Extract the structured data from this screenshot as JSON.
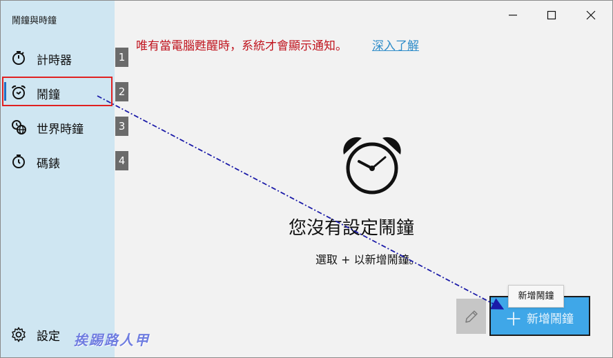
{
  "app": {
    "title": "鬧鐘與時鐘"
  },
  "sidebar": {
    "items": [
      {
        "label": "計時器",
        "icon": "timer-icon",
        "badge": "1"
      },
      {
        "label": "鬧鐘",
        "icon": "alarm-clock-icon",
        "badge": "2",
        "selected": true
      },
      {
        "label": "世界時鐘",
        "icon": "world-clock-icon",
        "badge": "3"
      },
      {
        "label": "碼錶",
        "icon": "stopwatch-icon",
        "badge": "4"
      }
    ],
    "settings_label": "設定",
    "settings_icon": "gear-icon"
  },
  "window_controls": {
    "minimize_icon": "minimize-icon",
    "maximize_icon": "maximize-icon",
    "close_icon": "close-icon"
  },
  "main": {
    "notice": "唯有當電腦甦醒時，系統才會顯示通知。",
    "learn_more": "深入了解",
    "empty_icon": "alarm-clock-icon",
    "empty_title": "您沒有設定鬧鐘",
    "empty_subtitle": "選取 + 以新增鬧鐘。"
  },
  "toolbar": {
    "edit_icon": "pencil-icon",
    "add_label": "新增鬧鐘",
    "add_icon": "plus-icon",
    "tooltip": "新增鬧鐘"
  },
  "watermark": "挨踢路人甲",
  "colors": {
    "sidebar_bg": "#cfe6f2",
    "accent": "#1f6fc4",
    "notice_text": "#c0141e",
    "link": "#2e8cc9",
    "add_button": "#3fa7e8",
    "highlight_border": "#e02020",
    "annotation_arrow": "#1a1aa8"
  }
}
